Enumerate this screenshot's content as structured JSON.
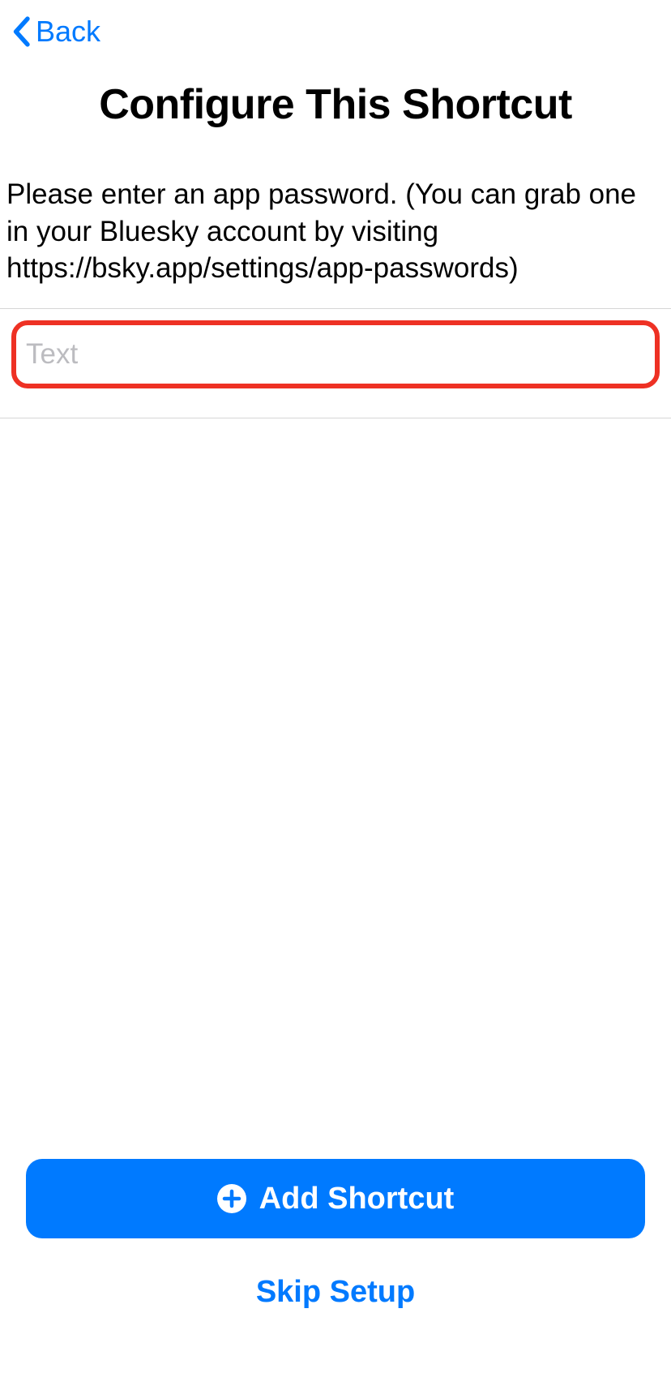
{
  "nav": {
    "back_label": "Back"
  },
  "header": {
    "title": "Configure This Shortcut"
  },
  "body": {
    "instruction": "Please enter an app password. (You can grab one in your Bluesky account by visiting https://bsky.app/settings/app-passwords)",
    "input_placeholder": "Text",
    "input_value": ""
  },
  "footer": {
    "add_label": "Add Shortcut",
    "skip_label": "Skip Setup"
  }
}
